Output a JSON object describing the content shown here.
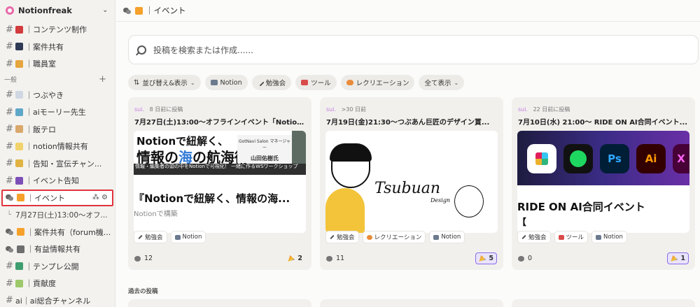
{
  "sidebar": {
    "server_name": "Notionfreak",
    "top_channels": [
      {
        "label": "｜コンテンツ制作",
        "color": "#d13b3b"
      },
      {
        "label": "｜案件共有",
        "color": "#2f3a56"
      },
      {
        "label": "｜職員室",
        "color": "#e5a63d"
      }
    ],
    "category": "一般",
    "channels": [
      {
        "label": "｜つぶやき",
        "color": "#cfd7e3"
      },
      {
        "label": "｜aiモーリー先生",
        "color": "#5fa7c8"
      },
      {
        "label": "｜飯テロ",
        "color": "#d9a86a"
      },
      {
        "label": "｜notion情報共有",
        "color": "#f2d36b"
      },
      {
        "label": "｜告知・宣伝チャン...",
        "color": "#e0b342"
      },
      {
        "label": "｜イベント告知",
        "color": "#7c4fb8"
      }
    ],
    "active_channel": {
      "label": "｜イベント",
      "color": "#f5a12b"
    },
    "thread": "7月27日(土)13:00〜オフ...",
    "after": [
      {
        "label": "｜案件共有（forum機...",
        "color": "#f5a12b",
        "forum": true
      },
      {
        "label": "｜有益情報共有",
        "color": "#6e6e6e",
        "forum": true
      },
      {
        "label": "｜テンプレ公開",
        "color": "#3f9e6f",
        "forum": false
      },
      {
        "label": "｜貢献度",
        "color": "#9dc96b",
        "forum": false
      },
      {
        "label": "ai｜ai総合チャンネル",
        "color": "",
        "forum": false
      }
    ]
  },
  "topbar": {
    "title": "｜イベント"
  },
  "search": {
    "placeholder": "投稿を検索または作成......"
  },
  "filters": {
    "sort": "並び替え&表示",
    "tags": [
      "Notion",
      "勉強会",
      "ツール",
      "レクリエーション"
    ],
    "show_all": "全て表示"
  },
  "cards": [
    {
      "author": "sui.",
      "time": "8 日前に投稿",
      "title": "7月27日(土)13:00〜オフラインイベント「Notionで紐解く、情報の海の航海術」",
      "thumb": {
        "line1": "Notionで紐解く、",
        "line2a": "情報の",
        "line2b": "海",
        "line2c": "の航海術",
        "bar": "情報・編集者の頭の中をNotionで可視化！ 一緒に作るWSワークショップ",
        "plate_role": "GotNavi Salon マネージャー",
        "plate_name": "山田佑樹氏",
        "headline": "『Notionで紐解く、情報の海...",
        "sub": "Notionで構築"
      },
      "tags": [
        "勉強会",
        "Notion"
      ],
      "comments": "12",
      "reactions": "2",
      "reacted": false
    },
    {
      "author": "sui.",
      "time": ">30 日前",
      "title": "7月19日(金)21:30〜つぶあん巨匠のデザイン賞...",
      "thumb": {
        "logo": "Tsubuan",
        "logo_sub": "Design"
      },
      "tags": [
        "勉強会",
        "レクリエーション",
        "Notion"
      ],
      "comments": "11",
      "reactions": "5",
      "reacted": true
    },
    {
      "author": "sui.",
      "time": "22 日前に投稿",
      "title": "7月10日(水) 21:00〜 RIDE ON AI合同イベント...",
      "thumb": {
        "apps": [
          "",
          "",
          "Ps",
          "Ai",
          "X"
        ],
        "headline": "RIDE ON AI合同イベント",
        "sub": "【"
      },
      "tags": [
        "勉強会",
        "ツール",
        "Notion"
      ],
      "comments": "0",
      "reactions": "1",
      "reacted": true
    }
  ],
  "past_posts_label": "過去の投稿",
  "colors": {
    "accent_highlight": "#e0343e",
    "reaction_bg": "#e9e3fb"
  }
}
